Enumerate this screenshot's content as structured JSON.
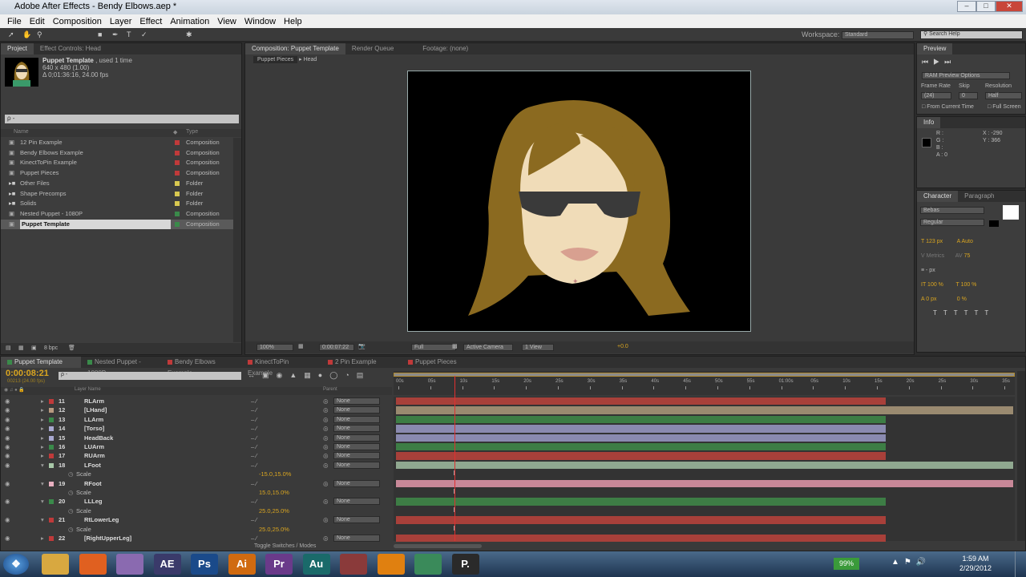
{
  "window": {
    "title": "Adobe After Effects - Bendy Elbows.aep *"
  },
  "menu": [
    "File",
    "Edit",
    "Composition",
    "Layer",
    "Effect",
    "Animation",
    "View",
    "Window",
    "Help"
  ],
  "toolbar": {
    "workspace_label": "Workspace:",
    "workspace_value": "Standard",
    "search_placeholder": "Search Help"
  },
  "project": {
    "tabs": [
      "Project",
      "Effect Controls: Head"
    ],
    "item_name": "Puppet Template",
    "item_used": ", used 1 time",
    "item_size": "640 x 480 (1.00)",
    "item_duration": "Δ 0;01:36:16, 24.00 fps",
    "search_placeholder": "ρ -",
    "col_name": "Name",
    "col_type": "Type",
    "items": [
      {
        "name": "12 Pin Example",
        "type": "Composition",
        "color": "#c03a3a"
      },
      {
        "name": "Bendy Elbows Example",
        "type": "Composition",
        "color": "#c03a3a"
      },
      {
        "name": "KinectToPin Example",
        "type": "Composition",
        "color": "#c03a3a"
      },
      {
        "name": "Puppet Pieces",
        "type": "Composition",
        "color": "#c03a3a"
      },
      {
        "name": "Other Files",
        "type": "Folder",
        "color": "#d8c850"
      },
      {
        "name": "Shape Precomps",
        "type": "Folder",
        "color": "#d8c850"
      },
      {
        "name": "Solids",
        "type": "Folder",
        "color": "#d8c850"
      },
      {
        "name": "Nested Puppet - 1080P",
        "type": "Composition",
        "color": "#3a8a4a"
      },
      {
        "name": "Puppet Template",
        "type": "Composition",
        "color": "#3a8a4a"
      }
    ],
    "bpc": "8 bpc"
  },
  "comp": {
    "tabs": [
      "Composition: Puppet Template",
      "Render Queue",
      "Footage: (none)"
    ],
    "breadcrumbs": [
      "Puppet Pieces",
      "Head"
    ],
    "zoom": "100%",
    "timecode": "0:00:07:22",
    "resolution": "Full",
    "camera": "Active Camera",
    "views": "1 View",
    "exposure": "+0.0"
  },
  "preview": {
    "tab": "Preview",
    "ram_options": "RAM Preview Options",
    "frame_rate_label": "Frame Rate",
    "skip_label": "Skip",
    "resolution_label": "Resolution",
    "frame_rate": "(24)",
    "skip": "0",
    "resolution": "Half",
    "from_current": "From Current Time",
    "full_screen": "Full Screen"
  },
  "info": {
    "tab": "Info",
    "r": "R :",
    "g": "G :",
    "b": "B :",
    "a": "A : 0",
    "x": "X : -290",
    "y": "Y : 366"
  },
  "character": {
    "tabs": [
      "Character",
      "Paragraph"
    ],
    "font": "Bebas",
    "style": "Regular",
    "size": "123 px",
    "leading": "Auto",
    "kerning": "Metrics",
    "tracking": "75",
    "stroke": "- px",
    "vscale": "100 %",
    "hscale": "100 %",
    "baseline": "0 px",
    "tsume": "0 %"
  },
  "timeline": {
    "tabs": [
      {
        "name": "Puppet Template",
        "color": "#3a8a4a"
      },
      {
        "name": "Nested Puppet - 1080P",
        "color": "#3a8a4a"
      },
      {
        "name": "Bendy Elbows Example",
        "color": "#c03a3a"
      },
      {
        "name": "KinectToPin Example",
        "color": "#c03a3a"
      },
      {
        "name": "2 Pin Example",
        "color": "#c03a3a"
      },
      {
        "name": "Puppet Pieces",
        "color": "#c03a3a"
      }
    ],
    "timecode": "0:00:08:21",
    "frame_info": "00213 (24.00 fps)",
    "search_placeholder": "ρ -",
    "col_layer_name": "Layer Name",
    "col_parent": "Parent",
    "toggle_label": "Toggle Switches / Modes",
    "ruler": [
      "00s",
      "05s",
      "10s",
      "15s",
      "20s",
      "25s",
      "30s",
      "35s",
      "40s",
      "45s",
      "50s",
      "55s",
      "01:00s",
      "05s",
      "10s",
      "15s",
      "20s",
      "25s",
      "30s",
      "35s"
    ],
    "playhead_seconds": 9.2,
    "layers": [
      {
        "num": "11",
        "name": "RLArm",
        "color": "#c03a3a",
        "parent": "None",
        "bar": "#a8403a",
        "end": "short"
      },
      {
        "num": "12",
        "name": "[LHand]",
        "color": "#b89a80",
        "parent": "None",
        "bar": "#9a8a70",
        "end": "long"
      },
      {
        "num": "13",
        "name": "LLArm",
        "color": "#3a8a4a",
        "parent": "None",
        "bar": "#3d7d45",
        "end": "short"
      },
      {
        "num": "14",
        "name": "[Torso]",
        "color": "#a8a8d0",
        "parent": "None",
        "bar": "#8a8ab0",
        "end": "short"
      },
      {
        "num": "15",
        "name": "HeadBack",
        "color": "#a8a8d0",
        "parent": "None",
        "bar": "#8a8ab0",
        "end": "short"
      },
      {
        "num": "16",
        "name": "LUArm",
        "color": "#3a8a4a",
        "parent": "None",
        "bar": "#3d7d45",
        "end": "short"
      },
      {
        "num": "17",
        "name": "RUArm",
        "color": "#c03a3a",
        "parent": "None",
        "bar": "#a8403a",
        "end": "short"
      },
      {
        "num": "18",
        "name": "LFoot",
        "color": "#a8c8a8",
        "parent": "None",
        "bar": "#90a890",
        "end": "long",
        "scale": "-15.0,15.0%"
      },
      {
        "num": "19",
        "name": "RFoot",
        "color": "#e8b0c0",
        "parent": "None",
        "bar": "#c88898",
        "end": "long",
        "scale": "15.0,15.0%"
      },
      {
        "num": "20",
        "name": "LLLeg",
        "color": "#3a8a4a",
        "parent": "None",
        "bar": "#3d7d45",
        "end": "short",
        "scale": "25.0,25.0%"
      },
      {
        "num": "21",
        "name": "RtLowerLeg",
        "color": "#c03a3a",
        "parent": "None",
        "bar": "#a8403a",
        "end": "short",
        "scale": "25.0,25.0%"
      },
      {
        "num": "22",
        "name": "[RightUpperLeg]",
        "color": "#c03a3a",
        "parent": "None",
        "bar": "#a8403a",
        "end": "short"
      }
    ],
    "scale_label": "Scale"
  },
  "taskbar": {
    "apps": [
      {
        "label": "",
        "color": "#d8a840"
      },
      {
        "label": "",
        "color": "#e06020"
      },
      {
        "label": "",
        "color": "#8a6ab0"
      },
      {
        "label": "AE",
        "color": "#3a3a6a"
      },
      {
        "label": "Ps",
        "color": "#1a4a8a"
      },
      {
        "label": "Ai",
        "color": "#d06a10"
      },
      {
        "label": "Pr",
        "color": "#6a3a8a"
      },
      {
        "label": "Au",
        "color": "#1a6a6a"
      },
      {
        "label": "",
        "color": "#8a3a3a"
      },
      {
        "label": "",
        "color": "#e08010"
      },
      {
        "label": "",
        "color": "#3a8a5a"
      },
      {
        "label": "P.",
        "color": "#2a2a2a"
      }
    ],
    "battery": "99%",
    "time": "1:59 AM",
    "date": "2/29/2012"
  }
}
